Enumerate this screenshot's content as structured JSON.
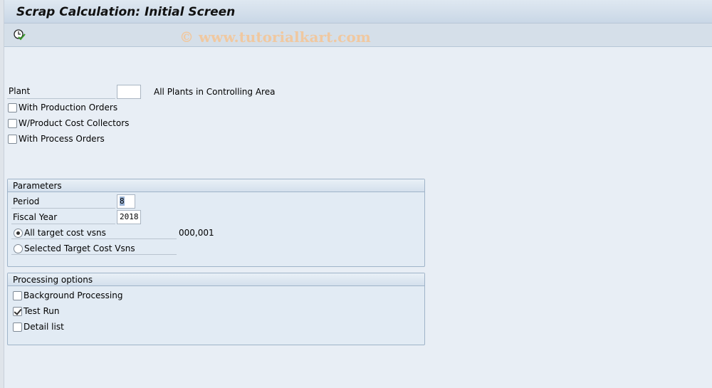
{
  "window": {
    "title": "Scrap Calculation: Initial Screen"
  },
  "toolbar": {
    "execute_icon": "clock-check-icon",
    "watermark": "© www.tutorialkart.com"
  },
  "selection": {
    "plant_label": "Plant",
    "plant_value": "",
    "plant_hint": "All Plants in Controlling Area",
    "checkboxes": [
      {
        "label": "With Production Orders",
        "checked": false
      },
      {
        "label": "W/Product Cost Collectors",
        "checked": false
      },
      {
        "label": "With Process Orders",
        "checked": false
      }
    ]
  },
  "parameters": {
    "title": "Parameters",
    "period_label": "Period",
    "period_value": "8",
    "year_label": "Fiscal Year",
    "year_value": "2018",
    "radio_all": "All target cost vsns",
    "radio_all_value": "000,001",
    "radio_selected": "Selected Target Cost Vsns",
    "selected_option": "All target cost vsns"
  },
  "processing": {
    "title": "Processing options",
    "options": [
      {
        "label": "Background Processing",
        "checked": false
      },
      {
        "label": "Test Run",
        "checked": true
      },
      {
        "label": "Detail list",
        "checked": false
      }
    ]
  }
}
